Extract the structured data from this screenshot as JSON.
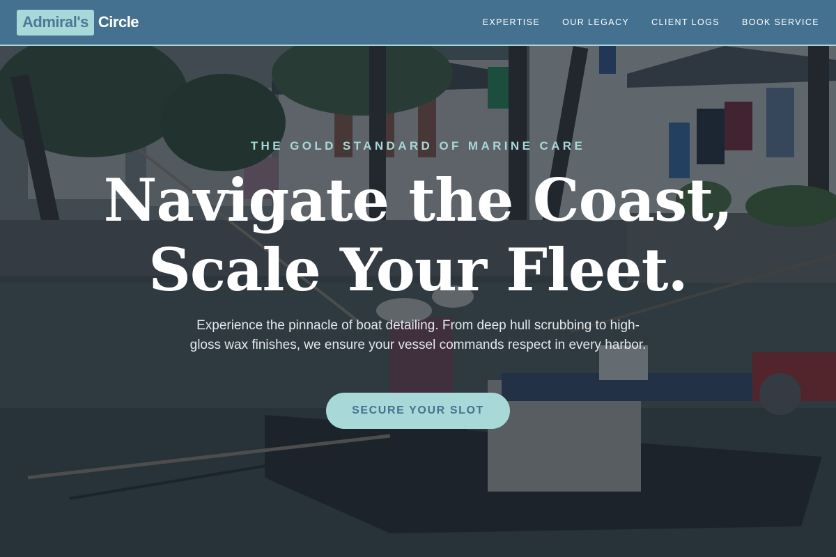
{
  "brand": {
    "badge": "Admiral's",
    "name": "Circle"
  },
  "nav": {
    "items": [
      {
        "label": "EXPERTISE"
      },
      {
        "label": "OUR LEGACY"
      },
      {
        "label": "CLIENT LOGS"
      },
      {
        "label": "BOOK SERVICE"
      }
    ]
  },
  "hero": {
    "eyebrow": "THE GOLD STANDARD OF MARINE CARE",
    "headline_line1": "Navigate the Coast,",
    "headline_line2": "Scale Your Fleet.",
    "subtext": "Experience the pinnacle of boat detailing. From deep hull scrubbing to high-gloss wax finishes, we ensure your vessel commands respect in every harbor.",
    "cta_label": "SECURE YOUR SLOT"
  },
  "colors": {
    "header_bg": "#457190",
    "accent": "#a9d8d9",
    "overlay": "rgba(20,30,44,0.62)"
  }
}
